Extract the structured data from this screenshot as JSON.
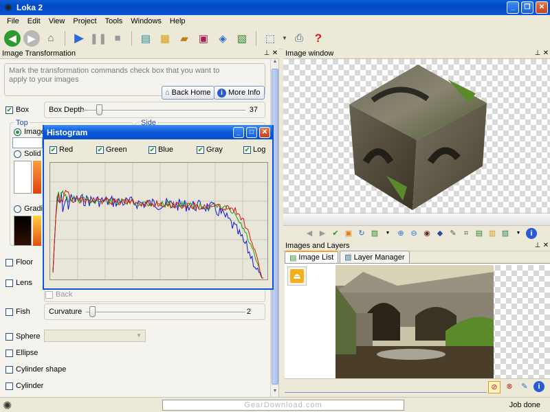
{
  "window": {
    "title": "Loka 2"
  },
  "menu": [
    "File",
    "Edit",
    "View",
    "Project",
    "Tools",
    "Windows",
    "Help"
  ],
  "left_panel": {
    "title": "Image Transformation",
    "hint": "Mark the transformation commands check box that you want to apply to your images",
    "back_home": "Back Home",
    "more_info": "More Info",
    "box": {
      "label": "Box",
      "checked": true,
      "depth_label": "Box Depth",
      "depth_value": "37",
      "depth_fraction": 0.08
    },
    "top_label": "Top",
    "side_label": "Side",
    "image_label": "Image",
    "solid_color_label": "Solid Co",
    "gradient_label": "Gradien",
    "back_label": "Back",
    "floor_label": "Floor",
    "lens_label": "Lens",
    "fish": {
      "label": "Fish",
      "curvature_label": "Curvature",
      "curvature_value": "2",
      "curvature_fraction": 0.02
    },
    "sphere_label": "Sphere",
    "ellipse_label": "Ellipse",
    "cylinder_shape_label": "Cylinder shape",
    "cylinder_label": "Cylinder"
  },
  "image_window": {
    "title": "Image window"
  },
  "images_layers": {
    "title": "Images and Layers",
    "tabs": [
      "Image List",
      "Layer Manager"
    ]
  },
  "histogram": {
    "title": "Histogram",
    "channels": [
      {
        "label": "Red",
        "checked": true
      },
      {
        "label": "Green",
        "checked": true
      },
      {
        "label": "Blue",
        "checked": true
      },
      {
        "label": "Gray",
        "checked": true
      },
      {
        "label": "Log",
        "checked": true
      }
    ],
    "colors": {
      "red": "#e01010",
      "green": "#10a010",
      "blue": "#1010e0"
    }
  },
  "status": {
    "center_text": "GearDownload.com",
    "right_text": "Job done"
  }
}
